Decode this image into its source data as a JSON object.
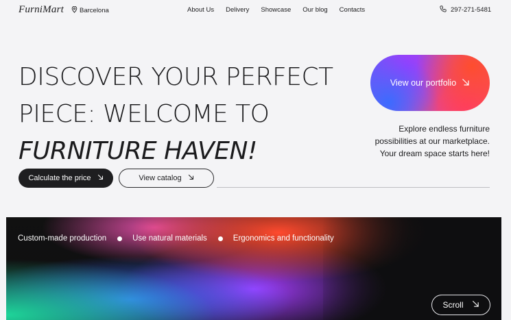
{
  "header": {
    "logo": "FurniMart",
    "location": "Barcelona",
    "nav": [
      "About Us",
      "Delivery",
      "Showcase",
      "Our blog",
      "Contacts"
    ],
    "phone": "297-271-5481"
  },
  "hero": {
    "title_line1": "DISCOVER YOUR PERFECT",
    "title_line2": "PIECE: WELCOME TO",
    "title_line3": "FURNITURE HAVEN!",
    "portfolio_button": "View our portfolio",
    "subtitle": "Explore endless furniture possibilities at our marketplace. Your dream space starts here!",
    "calculate_button": "Calculate the price",
    "catalog_button": "View catalog"
  },
  "banner": {
    "features": [
      "Custom-made production",
      "Use natural materials",
      "Ergonomics and functionality"
    ],
    "scroll_button": "Scroll"
  },
  "icons": {
    "location": "location-pin-icon",
    "phone": "phone-icon",
    "arrow": "arrow-down-right-icon"
  }
}
